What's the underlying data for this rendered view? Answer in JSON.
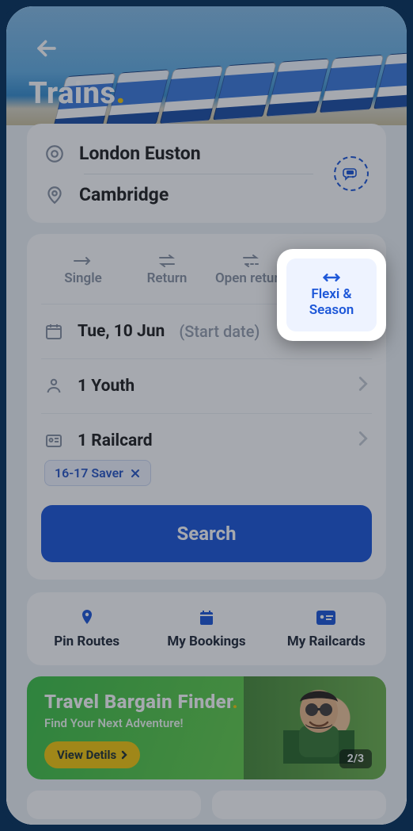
{
  "header": {
    "title": "Trains"
  },
  "stations": {
    "origin": "London Euston",
    "destination": "Cambridge"
  },
  "tabs": {
    "single": "Single",
    "return": "Return",
    "open_return": "Open return",
    "flexi": "Flexi & Season",
    "active": "flexi"
  },
  "date_row": {
    "value": "Tue, 10 Jun",
    "hint": "(Start date)"
  },
  "passengers_row": {
    "value": "1 Youth"
  },
  "railcard_row": {
    "value": "1 Railcard",
    "chip": "16-17 Saver"
  },
  "search_button": "Search",
  "shortcuts": {
    "pin": "Pin Routes",
    "bookings": "My Bookings",
    "railcards": "My Railcards"
  },
  "banner": {
    "title": "Travel Bargain Finder",
    "subtitle": "Find Your Next Adventure!",
    "cta": "View Detils",
    "page_indicator": "2/3"
  }
}
